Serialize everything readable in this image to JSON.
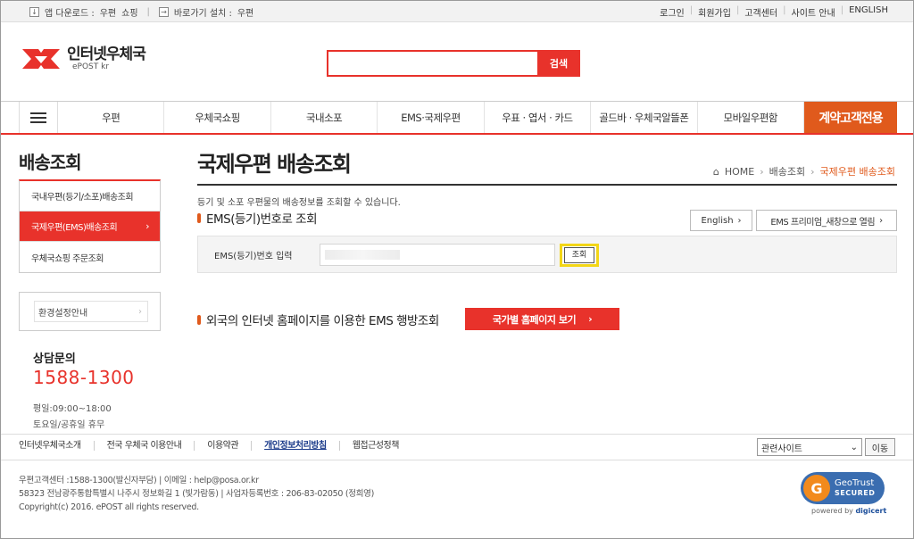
{
  "util": {
    "app_download": "앱 다운로드 :",
    "app_links": [
      "우편",
      "쇼핑"
    ],
    "shortcut": "바로가기 설치 :",
    "shortcut_link": "우편",
    "right_links": [
      "로그인",
      "회원가입",
      "고객센터",
      "사이트 안내",
      "ENGLISH"
    ]
  },
  "header": {
    "logo_kr": "인터넷우체국",
    "logo_en": "ePOST kr",
    "search_value": "",
    "search_button": "검색"
  },
  "gnb": {
    "items": [
      "우편",
      "우체국쇼핑",
      "국내소포",
      "EMS·국제우편",
      "우표 · 엽서 · 카드",
      "골드바 · 우체국알뜰폰",
      "모바일우편함"
    ],
    "special": "계약고객전용"
  },
  "lnb": {
    "title": "배송조회",
    "items": [
      "국내우편(등기/소포)배송조회",
      "국제우편(EMS)배송조회",
      "우체국쇼핑 주문조회"
    ],
    "active_index": 1,
    "env": "환경설정안내",
    "cs_title": "상담문의",
    "cs_phone": "1588-1300",
    "cs_hours1": "평일:09:00~18:00",
    "cs_hours2": "토요일/공휴일 휴무"
  },
  "content": {
    "title": "국제우편 배송조회",
    "breadcrumb": [
      "HOME",
      "배송조회",
      "국제우편 배송조회"
    ],
    "desc": "등기 및 소포 우편물의 배송정보를 조회할 수 있습니다.",
    "section1": "EMS(등기)번호로 조회",
    "btn_english": "English",
    "btn_premium": "EMS 프리미엄_새창으로 열림",
    "input_label": "EMS(등기)번호 입력",
    "input_value": "",
    "lookup_button": "조회",
    "section2": "외국의 인터넷 홈페이지를 이용한 EMS 행방조회",
    "btn_country": "국가별 홈페이지 보기"
  },
  "footer": {
    "links": [
      "인터넷우체국소개",
      "전국 우체국 이용안내",
      "이용약관",
      "개인정보처리방침",
      "웹접근성정책"
    ],
    "highlight_index": 3,
    "select_value": "관련사이트",
    "go_button": "이동",
    "info_line1": "우편고객센터 :1588-1300(발신자부담)   |   이메일 : help@posa.or.kr",
    "info_line2": "58323 전남광주통합특별시 나주시 정보화길 1 (빛가람동)   |   사업자등록번호 : 206-83-02050 (정희영)",
    "info_line3": "Copyright(c) 2016. ePOST all rights reserved.",
    "geotrust_1": "GeoTrust",
    "geotrust_2": "SECURED",
    "powered": "powered by",
    "digicert": "digicert"
  },
  "colors": {
    "accent": "#e8322b",
    "orange": "#e05a1c",
    "highlight": "#f3d616"
  }
}
